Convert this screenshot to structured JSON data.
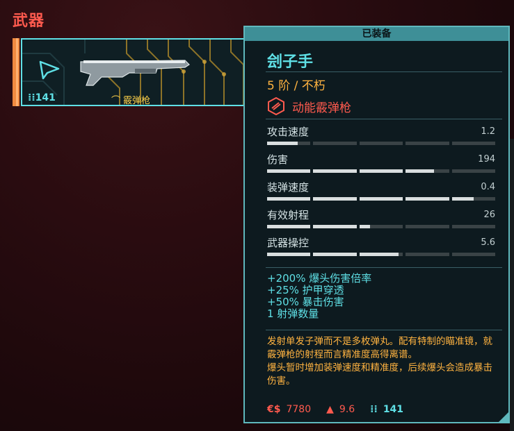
{
  "section": {
    "title": "武器"
  },
  "card": {
    "ammo": "141",
    "weapon_type": "霰弹枪"
  },
  "panel": {
    "header": "已装备",
    "name": "刽子手",
    "tier": "5 阶 / 不朽",
    "weapon_class": "动能霰弹枪",
    "stats": [
      {
        "label": "攻击速度",
        "value": "1.2",
        "fill": 0.14
      },
      {
        "label": "伤害",
        "value": "194",
        "fill": 0.73
      },
      {
        "label": "装弹速度",
        "value": "0.4",
        "fill": 0.9
      },
      {
        "label": "有效射程",
        "value": "26",
        "fill": 0.45
      },
      {
        "label": "武器操控",
        "value": "5.6",
        "fill": 0.58
      }
    ],
    "bonuses": [
      "+200% 爆头伤害倍率",
      "+25% 护甲穿透",
      "+50% 暴击伤害",
      "1 射弹数量"
    ],
    "description": [
      "发射单发子弹而不是多枚弹丸。配有特制的瞄准镜，就霰弹枪的射程而言精准度高得离谱。",
      "爆头暂时增加装弹速度和精准度，后续爆头会造成暴击伤害。"
    ],
    "footer": {
      "price_icon": "€$",
      "price": "7780",
      "weight": "9.6",
      "ammo": "141"
    }
  },
  "colors": {
    "cyan": "#5fe0e6",
    "red": "#ff5a4e",
    "gold": "#ffb340"
  }
}
